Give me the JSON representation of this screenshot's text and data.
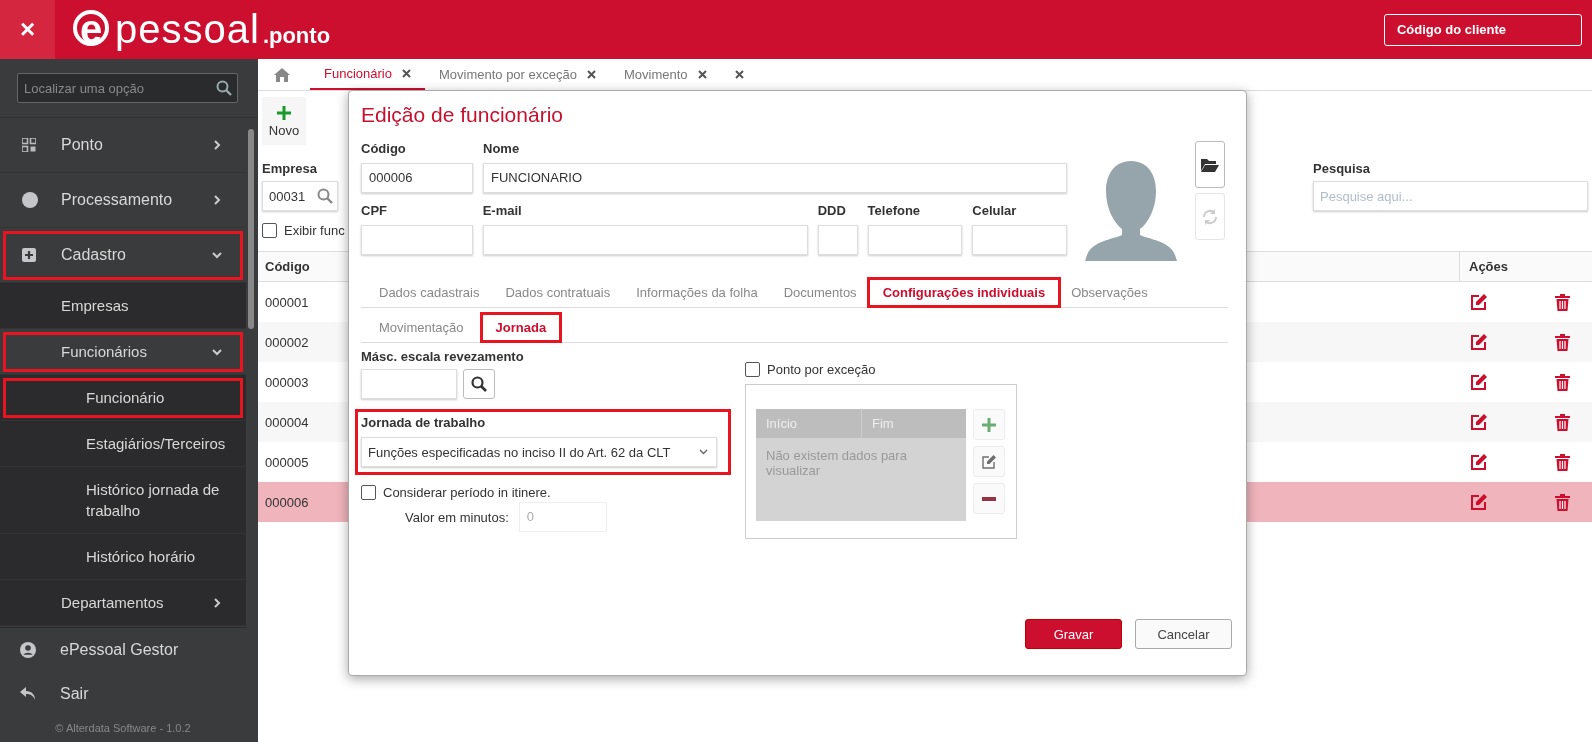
{
  "header": {
    "close_icon": "×",
    "logo": {
      "mark": "e",
      "name": "pessoal",
      "suffix": ".ponto"
    },
    "client_button": "Código do cliente"
  },
  "sidebar": {
    "search": {
      "placeholder": "Localizar uma opção"
    },
    "items": [
      {
        "label": "Ponto",
        "expanded": false,
        "highlighted": false
      },
      {
        "label": "Processamento",
        "expanded": false,
        "highlighted": false
      },
      {
        "label": "Cadastro",
        "expanded": true,
        "highlighted": true,
        "children": [
          {
            "label": "Empresas",
            "highlighted": false
          },
          {
            "label": "Funcionários",
            "expanded": true,
            "highlighted": true,
            "children": [
              {
                "label": "Funcionário",
                "highlighted": true
              },
              {
                "label": "Estagiários/Terceiros",
                "highlighted": false
              },
              {
                "label": "Histórico jornada de trabalho",
                "highlighted": false
              },
              {
                "label": "Histórico horário",
                "highlighted": false
              }
            ]
          },
          {
            "label": "Departamentos",
            "expanded": false,
            "highlighted": false
          }
        ]
      }
    ],
    "bottom_items": [
      {
        "label": "ePessoal Gestor"
      },
      {
        "label": "Sair"
      }
    ],
    "footer": "© Alterdata Software - 1.0.2"
  },
  "tabs": [
    {
      "label": "Funcionário",
      "selected": true
    },
    {
      "label": "Movimento por exceção",
      "selected": false
    },
    {
      "label": "Movimento",
      "selected": false
    },
    {
      "selected": false
    }
  ],
  "toolbar": {
    "new_button": "Novo"
  },
  "filters": {
    "company": {
      "label": "Empresa",
      "value": "00031"
    },
    "show_checkbox": {
      "label": "Exibir func",
      "checked": false
    },
    "search": {
      "label": "Pesquisa",
      "placeholder": "Pesquise aqui..."
    }
  },
  "table": {
    "columns": [
      "Código",
      "Ações"
    ],
    "rows": [
      {
        "code": "000001",
        "selected": false
      },
      {
        "code": "000002",
        "selected": false
      },
      {
        "code": "000003",
        "selected": false
      },
      {
        "code": "000004",
        "selected": false
      },
      {
        "code": "000005",
        "selected": false
      },
      {
        "code": "000006",
        "selected": true
      }
    ]
  },
  "modal": {
    "title": "Edição de funcionário",
    "fields": {
      "code": {
        "label": "Código",
        "value": "000006"
      },
      "name": {
        "label": "Nome",
        "value": "FUNCIONARIO"
      },
      "cpf": {
        "label": "CPF"
      },
      "email": {
        "label": "E-mail"
      },
      "ddd": {
        "label": "DDD"
      },
      "phone": {
        "label": "Telefone"
      },
      "mobile": {
        "label": "Celular"
      }
    },
    "photo_buttons": [
      {
        "disabled": false
      },
      {
        "disabled": true
      }
    ],
    "tabs": [
      {
        "label": "Dados cadastrais",
        "selected": false,
        "highlighted": false
      },
      {
        "label": "Dados contratuais",
        "selected": false,
        "highlighted": false
      },
      {
        "label": "Informações da folha",
        "selected": false,
        "highlighted": false
      },
      {
        "label": "Documentos",
        "selected": false,
        "highlighted": false
      },
      {
        "label": "Configurações individuais",
        "selected": true,
        "highlighted": true
      },
      {
        "label": "Observações",
        "selected": false,
        "highlighted": false
      }
    ],
    "subtabs": [
      {
        "label": "Movimentação",
        "selected": false,
        "highlighted": false
      },
      {
        "label": "Jornada",
        "selected": true,
        "highlighted": true
      }
    ],
    "schedule_mask": {
      "label": "Másc. escala revezamento"
    },
    "workday": {
      "label": "Jornada de trabalho",
      "value": "Funções especificadas no inciso II do Art. 62 da CLT",
      "highlighted": true
    },
    "itinere": {
      "label": "Considerar período in itinere.",
      "checked": false
    },
    "minutes": {
      "label": "Valor em minutos:",
      "value": "0",
      "disabled": true
    },
    "exception": {
      "label": "Ponto por exceção",
      "checked": false,
      "columns": [
        "Início",
        "Fim"
      ],
      "empty": "Não existem dados para visualizar",
      "buttons": [
        {
          "disabled": true
        },
        {
          "disabled": true
        },
        {
          "disabled": true
        }
      ]
    },
    "buttons": [
      {
        "label": "Gravar",
        "kind": "primary"
      },
      {
        "label": "Cancelar",
        "kind": "secondary"
      }
    ]
  }
}
